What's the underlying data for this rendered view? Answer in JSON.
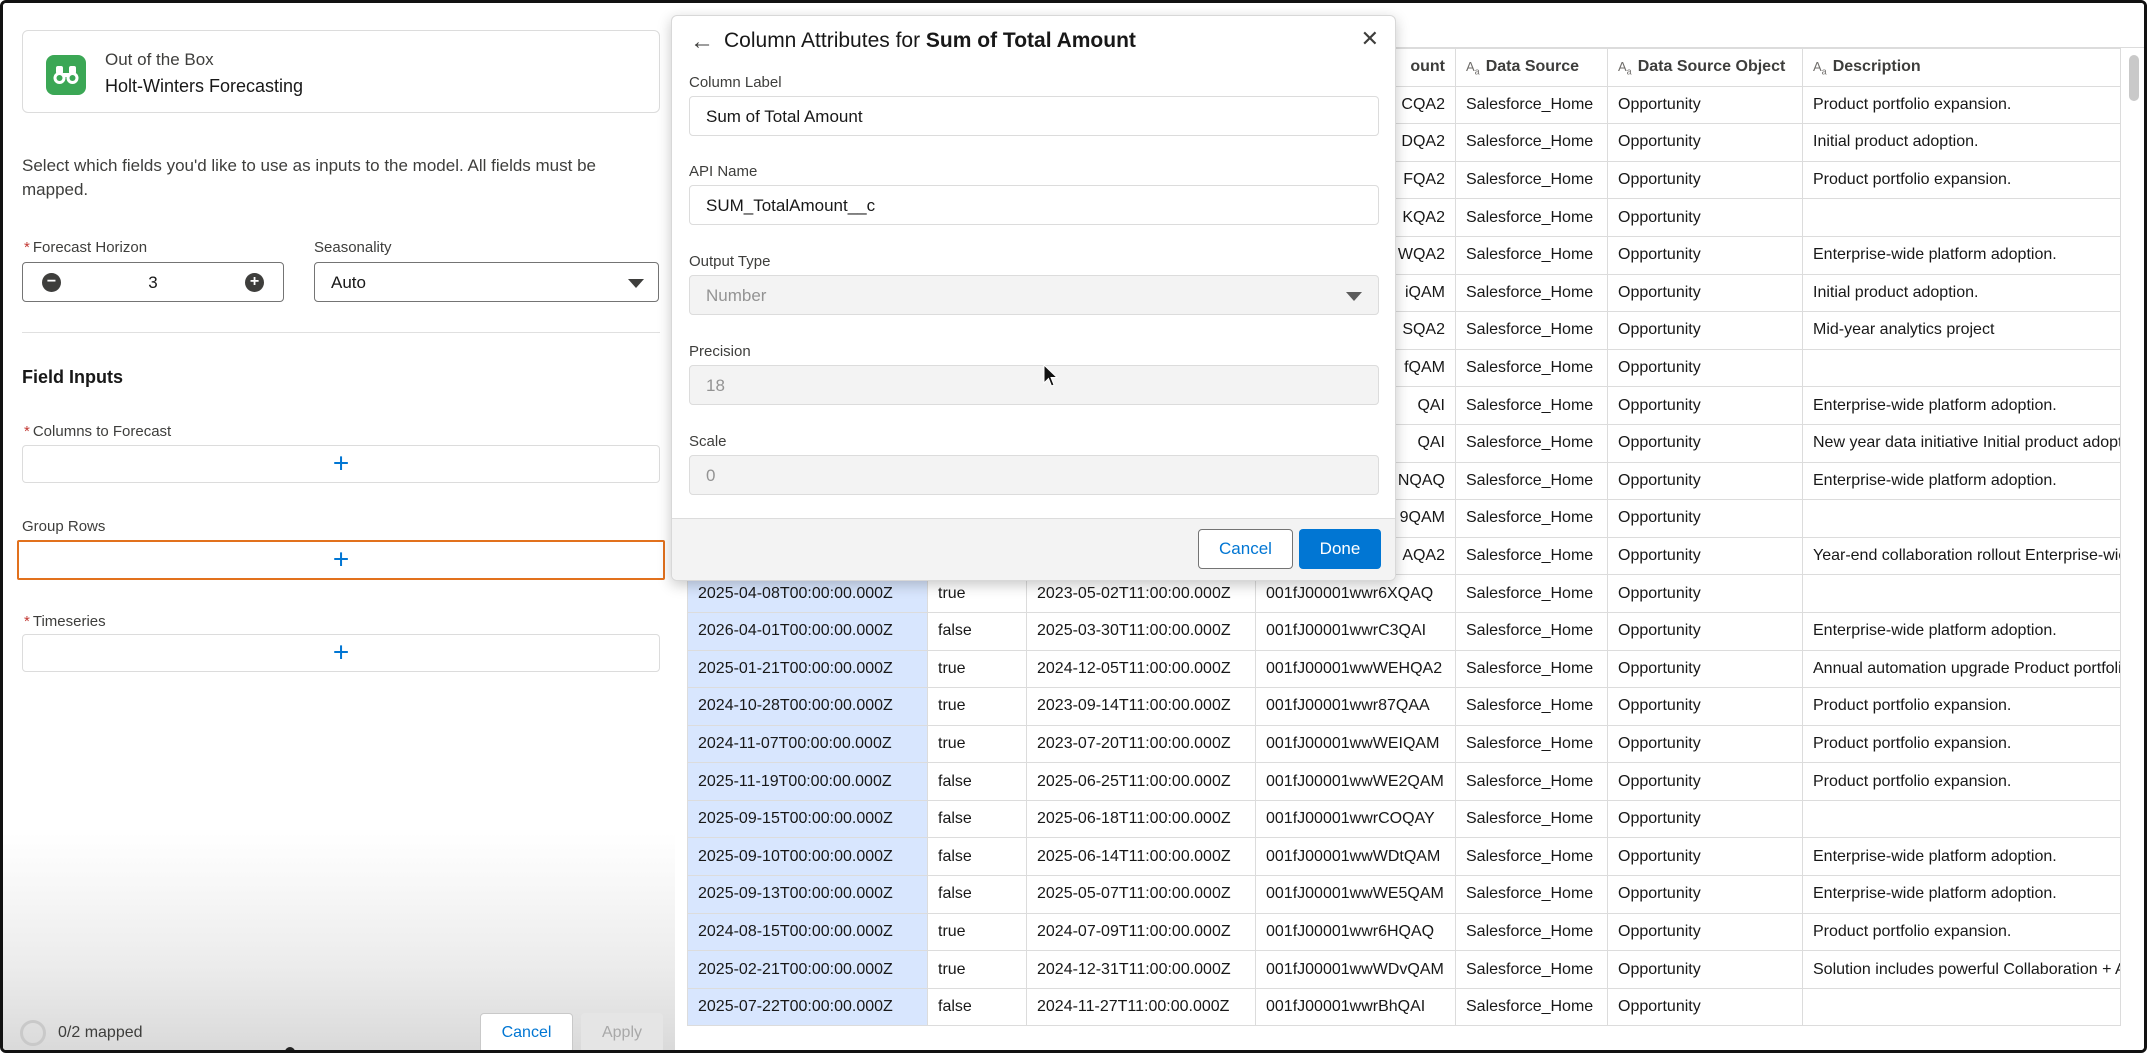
{
  "model": {
    "subtitle": "Out of the Box",
    "title": "Holt-Winters Forecasting",
    "icon": "binoculars-icon",
    "icon_color": "#3ba755"
  },
  "instructions": "Select which fields you'd like to use as inputs to the model. All fields must be mapped.",
  "forecast_horizon": {
    "label": "Forecast Horizon",
    "value": "3"
  },
  "seasonality": {
    "label": "Seasonality",
    "value": "Auto"
  },
  "field_inputs": {
    "title": "Field Inputs",
    "columns_to_forecast": "Columns to Forecast",
    "group_rows": "Group Rows",
    "timeseries": "Timeseries",
    "plus": "+"
  },
  "footer": {
    "mapped": "0/2 mapped",
    "cancel": "Cancel",
    "apply": "Apply"
  },
  "modal": {
    "title_prefix": "Column Attributes for ",
    "title_bold": "Sum of Total Amount",
    "back": "←",
    "close": "✕",
    "fields": {
      "column_label": {
        "label": "Column Label",
        "value": "Sum of Total Amount"
      },
      "api_name": {
        "label": "API Name",
        "value": "SUM_TotalAmount__c"
      },
      "output_type": {
        "label": "Output Type",
        "value": "Number"
      },
      "precision": {
        "label": "Precision",
        "value": "18"
      },
      "scale": {
        "label": "Scale",
        "value": "0"
      }
    },
    "cancel": "Cancel",
    "done": "Done"
  },
  "table": {
    "headers": {
      "h1": "",
      "h2": "",
      "h3": "",
      "h4": "ount",
      "h5": "Data Source",
      "h6": "Data Source Object",
      "h7": "Description",
      "aa": "A"
    },
    "rows": [
      {
        "c1": "",
        "c2": "",
        "c3": "",
        "c4": "CQA2",
        "c5": "Salesforce_Home",
        "c6": "Opportunity",
        "c7": "Product portfolio expansion."
      },
      {
        "c1": "",
        "c2": "",
        "c3": "",
        "c4": "DQA2",
        "c5": "Salesforce_Home",
        "c6": "Opportunity",
        "c7": "Initial product adoption."
      },
      {
        "c1": "",
        "c2": "",
        "c3": "",
        "c4": "FQA2",
        "c5": "Salesforce_Home",
        "c6": "Opportunity",
        "c7": "Product portfolio expansion."
      },
      {
        "c1": "",
        "c2": "",
        "c3": "",
        "c4": "KQA2",
        "c5": "Salesforce_Home",
        "c6": "Opportunity",
        "c7": ""
      },
      {
        "c1": "",
        "c2": "",
        "c3": "",
        "c4": "WQA2",
        "c5": "Salesforce_Home",
        "c6": "Opportunity",
        "c7": "Enterprise-wide platform adoption."
      },
      {
        "c1": "",
        "c2": "",
        "c3": "",
        "c4": "iQAM",
        "c5": "Salesforce_Home",
        "c6": "Opportunity",
        "c7": "Initial product adoption."
      },
      {
        "c1": "",
        "c2": "",
        "c3": "",
        "c4": "SQA2",
        "c5": "Salesforce_Home",
        "c6": "Opportunity",
        "c7": "Mid-year analytics project"
      },
      {
        "c1": "",
        "c2": "",
        "c3": "",
        "c4": "fQAM",
        "c5": "Salesforce_Home",
        "c6": "Opportunity",
        "c7": ""
      },
      {
        "c1": "",
        "c2": "",
        "c3": "",
        "c4": "QAI",
        "c5": "Salesforce_Home",
        "c6": "Opportunity",
        "c7": "Enterprise-wide platform adoption."
      },
      {
        "c1": "",
        "c2": "",
        "c3": "",
        "c4": "QAI",
        "c5": "Salesforce_Home",
        "c6": "Opportunity",
        "c7": "New year data initiative Initial product adopt"
      },
      {
        "c1": "",
        "c2": "",
        "c3": "",
        "c4": "NQAQ",
        "c5": "Salesforce_Home",
        "c6": "Opportunity",
        "c7": "Enterprise-wide platform adoption."
      },
      {
        "c1": "",
        "c2": "",
        "c3": "",
        "c4": "9QAM",
        "c5": "Salesforce_Home",
        "c6": "Opportunity",
        "c7": ""
      },
      {
        "c1": "",
        "c2": "",
        "c3": "",
        "c4": "AQA2",
        "c5": "Salesforce_Home",
        "c6": "Opportunity",
        "c7": "Year-end collaboration rollout Enterprise-wic"
      },
      {
        "c1": "2025-04-08T00:00:00.000Z",
        "c2": "true",
        "c3": "2023-05-02T11:00:00.000Z",
        "c4": "001fJ00001wwr6XQAQ",
        "c5": "Salesforce_Home",
        "c6": "Opportunity",
        "c7": ""
      },
      {
        "c1": "2026-04-01T00:00:00.000Z",
        "c2": "false",
        "c3": "2025-03-30T11:00:00.000Z",
        "c4": "001fJ00001wwrC3QAI",
        "c5": "Salesforce_Home",
        "c6": "Opportunity",
        "c7": "Enterprise-wide platform adoption."
      },
      {
        "c1": "2025-01-21T00:00:00.000Z",
        "c2": "true",
        "c3": "2024-12-05T11:00:00.000Z",
        "c4": "001fJ00001wwWEHQA2",
        "c5": "Salesforce_Home",
        "c6": "Opportunity",
        "c7": "Annual automation upgrade Product portfoli"
      },
      {
        "c1": "2024-10-28T00:00:00.000Z",
        "c2": "true",
        "c3": "2023-09-14T11:00:00.000Z",
        "c4": "001fJ00001wwr87QAA",
        "c5": "Salesforce_Home",
        "c6": "Opportunity",
        "c7": "Product portfolio expansion."
      },
      {
        "c1": "2024-11-07T00:00:00.000Z",
        "c2": "true",
        "c3": "2023-07-20T11:00:00.000Z",
        "c4": "001fJ00001wwWEIQAM",
        "c5": "Salesforce_Home",
        "c6": "Opportunity",
        "c7": "Product portfolio expansion."
      },
      {
        "c1": "2025-11-19T00:00:00.000Z",
        "c2": "false",
        "c3": "2025-06-25T11:00:00.000Z",
        "c4": "001fJ00001wwWE2QAM",
        "c5": "Salesforce_Home",
        "c6": "Opportunity",
        "c7": "Product portfolio expansion."
      },
      {
        "c1": "2025-09-15T00:00:00.000Z",
        "c2": "false",
        "c3": "2025-06-18T11:00:00.000Z",
        "c4": "001fJ00001wwrCOQAY",
        "c5": "Salesforce_Home",
        "c6": "Opportunity",
        "c7": ""
      },
      {
        "c1": "2025-09-10T00:00:00.000Z",
        "c2": "false",
        "c3": "2025-06-14T11:00:00.000Z",
        "c4": "001fJ00001wwWDtQAM",
        "c5": "Salesforce_Home",
        "c6": "Opportunity",
        "c7": "Enterprise-wide platform adoption."
      },
      {
        "c1": "2025-09-13T00:00:00.000Z",
        "c2": "false",
        "c3": "2025-05-07T11:00:00.000Z",
        "c4": "001fJ00001wwWE5QAM",
        "c5": "Salesforce_Home",
        "c6": "Opportunity",
        "c7": "Enterprise-wide platform adoption."
      },
      {
        "c1": "2024-08-15T00:00:00.000Z",
        "c2": "true",
        "c3": "2024-07-09T11:00:00.000Z",
        "c4": "001fJ00001wwr6HQAQ",
        "c5": "Salesforce_Home",
        "c6": "Opportunity",
        "c7": "Product portfolio expansion."
      },
      {
        "c1": "2025-02-21T00:00:00.000Z",
        "c2": "true",
        "c3": "2024-12-31T11:00:00.000Z",
        "c4": "001fJ00001wwWDvQAM",
        "c5": "Salesforce_Home",
        "c6": "Opportunity",
        "c7": "Solution includes powerful Collaboration + A"
      },
      {
        "c1": "2025-07-22T00:00:00.000Z",
        "c2": "false",
        "c3": "2024-11-27T11:00:00.000Z",
        "c4": "001fJ00001wwrBhQAI",
        "c5": "Salesforce_Home",
        "c6": "Opportunity",
        "c7": ""
      }
    ]
  },
  "colors": {
    "accent": "#0176d3",
    "focus_border": "#e2711d",
    "required": "#c23934",
    "selection": "#d8e6fe"
  }
}
